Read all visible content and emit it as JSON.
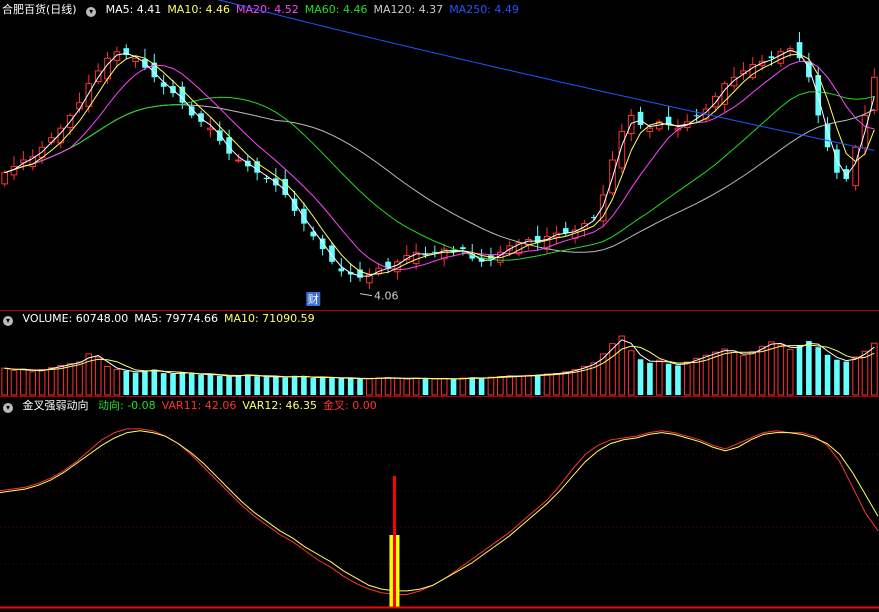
{
  "chart_data": [
    {
      "type": "candlestick",
      "title": "合肥百货(日线)",
      "indicators": [
        {
          "label": "MA5:",
          "value": "4.41",
          "color": "#ffffff"
        },
        {
          "label": "MA10:",
          "value": "4.46",
          "color": "#ffff66"
        },
        {
          "label": "MA20:",
          "value": "4.52",
          "color": "#ff44ff"
        },
        {
          "label": "MA60:",
          "value": "4.46",
          "color": "#22dd22"
        },
        {
          "label": "MA120:",
          "value": "4.37",
          "color": "#cccccc"
        },
        {
          "label": "MA250:",
          "value": "4.49",
          "color": "#2255ff"
        }
      ],
      "ylim": [
        4.02,
        4.9
      ],
      "close": [
        4.42,
        4.44,
        4.46,
        4.47,
        4.5,
        4.53,
        4.56,
        4.6,
        4.64,
        4.7,
        4.74,
        4.78,
        4.8,
        4.79,
        4.78,
        4.75,
        4.72,
        4.69,
        4.67,
        4.64,
        4.6,
        4.58,
        4.56,
        4.52,
        4.48,
        4.46,
        4.44,
        4.42,
        4.4,
        4.38,
        4.35,
        4.3,
        4.26,
        4.22,
        4.18,
        4.14,
        4.11,
        4.1,
        4.09,
        4.1,
        4.12,
        4.12,
        4.14,
        4.16,
        4.17,
        4.16,
        4.17,
        4.18,
        4.17,
        4.18,
        4.15,
        4.14,
        4.15,
        4.17,
        4.19,
        4.2,
        4.21,
        4.2,
        4.22,
        4.23,
        4.23,
        4.24,
        4.26,
        4.28,
        4.35,
        4.46,
        4.55,
        4.6,
        4.57,
        4.56,
        4.58,
        4.57,
        4.56,
        4.58,
        4.6,
        4.62,
        4.66,
        4.7,
        4.72,
        4.74,
        4.76,
        4.77,
        4.78,
        4.8,
        4.81,
        4.78,
        4.72,
        4.6,
        4.5,
        4.42,
        4.4,
        4.5,
        4.6,
        4.72
      ],
      "candle_colors": [
        "#66ffff",
        "#ff3232"
      ],
      "annotations": [
        {
          "text": "4.06",
          "color": "#cccccc"
        },
        {
          "text": "财",
          "color": "#ffffff",
          "background": "#3c6ed2"
        }
      ],
      "ma_colors": {
        "ma5": "#ffffff",
        "ma10": "#ffff66",
        "ma20": "#ff44ff",
        "ma60": "#22dd22",
        "ma120": "#bbbbbb",
        "ma250": "#2255ff"
      },
      "ma250_range": [
        5.17,
        4.49
      ]
    },
    {
      "type": "bar",
      "title": "VOLUME:",
      "indicators": [
        {
          "label": "VOLUME:",
          "value": "60748.00",
          "color": "#ffffff"
        },
        {
          "label": "MA5:",
          "value": "79774.66",
          "color": "#ffffff"
        },
        {
          "label": "MA10:",
          "value": "71090.59",
          "color": "#ffff66"
        }
      ],
      "ylim": [
        0,
        150000
      ],
      "values": [
        60000,
        55000,
        58000,
        52000,
        57000,
        61000,
        66000,
        70000,
        74000,
        92000,
        85000,
        64000,
        57000,
        54000,
        50000,
        55000,
        57000,
        49000,
        47000,
        51000,
        48000,
        45000,
        47000,
        43000,
        41000,
        44000,
        46000,
        42000,
        40000,
        42000,
        39000,
        43000,
        41000,
        38000,
        40000,
        39000,
        37000,
        38000,
        36000,
        37000,
        38000,
        39000,
        37000,
        36000,
        38000,
        37000,
        36000,
        37000,
        35000,
        38000,
        39000,
        37000,
        40000,
        41000,
        43000,
        42000,
        44000,
        45000,
        47000,
        48000,
        52000,
        57000,
        64000,
        72000,
        92000,
        115000,
        132000,
        99000,
        80000,
        72000,
        78000,
        70000,
        66000,
        74000,
        82000,
        89000,
        96000,
        103000,
        95000,
        88000,
        97000,
        109000,
        119000,
        112000,
        102000,
        110000,
        121000,
        107000,
        90000,
        79000,
        75000,
        85000,
        98000,
        116000
      ]
    },
    {
      "type": "line",
      "title": "金叉强弱动向",
      "indicators": [
        {
          "label": "动向:",
          "value": "-0.08",
          "color": "#22dd22"
        },
        {
          "label": "VAR11:",
          "value": "42.06",
          "color": "#ff3232"
        },
        {
          "label": "VAR12:",
          "value": "46.35",
          "color": "#ffff66"
        },
        {
          "label": "金叉:",
          "value": "0.00",
          "color": "#ff3232"
        }
      ],
      "ylim": [
        0,
        100
      ],
      "series": [
        {
          "name": "VAR11",
          "color": "#ff3232",
          "values": [
            60,
            61,
            62,
            64,
            67,
            71,
            76,
            82,
            88,
            92,
            94,
            94,
            93,
            90,
            86,
            80,
            73,
            66,
            59,
            52,
            46,
            41,
            36,
            32,
            27,
            22,
            18,
            13,
            9,
            6,
            4,
            3,
            3,
            5,
            8,
            12,
            17,
            22,
            27,
            32,
            37,
            43,
            49,
            55,
            63,
            72,
            80,
            85,
            88,
            89,
            90,
            92,
            93,
            92,
            90,
            88,
            85,
            83,
            86,
            89,
            92,
            93,
            92,
            92,
            90,
            85,
            76,
            62,
            48,
            38
          ]
        },
        {
          "name": "VAR12",
          "color": "#ffff66",
          "values": [
            59,
            60,
            61,
            63,
            66,
            70,
            75,
            80,
            85,
            89,
            92,
            93,
            92,
            90,
            86,
            81,
            75,
            68,
            61,
            54,
            48,
            43,
            38,
            34,
            29,
            25,
            21,
            16,
            12,
            8,
            6,
            5,
            5,
            6,
            8,
            12,
            16,
            20,
            25,
            30,
            35,
            41,
            47,
            53,
            60,
            68,
            76,
            82,
            86,
            88,
            89,
            91,
            92,
            91,
            89,
            87,
            84,
            82,
            84,
            88,
            91,
            92,
            92,
            91,
            89,
            86,
            80,
            70,
            58,
            46
          ]
        }
      ],
      "signal": {
        "color": "#ff0000",
        "cross_color": "#ffff00"
      },
      "baseline_color": "#ff0000"
    }
  ]
}
